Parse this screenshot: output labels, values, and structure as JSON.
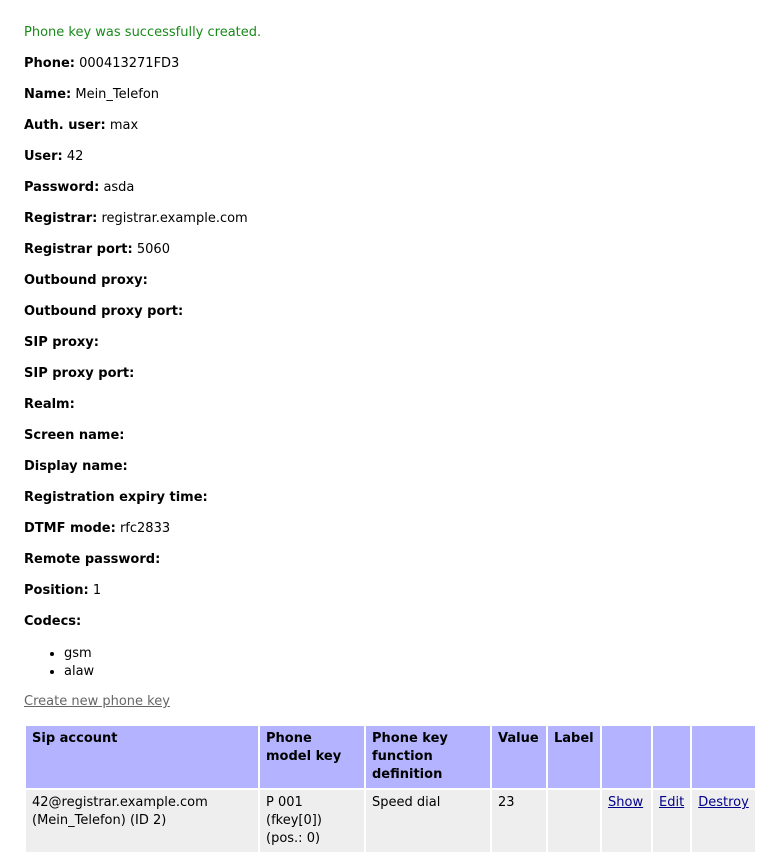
{
  "flash": "Phone key was successfully created.",
  "fields": [
    {
      "label": "Phone:",
      "value": "000413271FD3"
    },
    {
      "label": "Name:",
      "value": "Mein_Telefon"
    },
    {
      "label": "Auth. user:",
      "value": "max"
    },
    {
      "label": "User:",
      "value": "42"
    },
    {
      "label": "Password:",
      "value": "asda"
    },
    {
      "label": "Registrar:",
      "value": "registrar.example.com"
    },
    {
      "label": "Registrar port:",
      "value": "5060"
    },
    {
      "label": "Outbound proxy:",
      "value": ""
    },
    {
      "label": "Outbound proxy port:",
      "value": ""
    },
    {
      "label": "SIP proxy:",
      "value": ""
    },
    {
      "label": "SIP proxy port:",
      "value": ""
    },
    {
      "label": "Realm:",
      "value": ""
    },
    {
      "label": "Screen name:",
      "value": ""
    },
    {
      "label": "Display name:",
      "value": ""
    },
    {
      "label": "Registration expiry time:",
      "value": ""
    },
    {
      "label": "DTMF mode:",
      "value": "rfc2833"
    },
    {
      "label": "Remote password:",
      "value": ""
    },
    {
      "label": "Position:",
      "value": "1"
    },
    {
      "label": "Codecs:",
      "value": ""
    }
  ],
  "codecs": [
    "gsm",
    "alaw"
  ],
  "create_link": "Create new phone key",
  "table": {
    "headers": [
      "Sip account",
      "Phone model key",
      "Phone key function definition",
      "Value",
      "Label",
      "",
      "",
      ""
    ],
    "rows": [
      {
        "sip_account": "42@registrar.example.com (Mein_Telefon) (ID 2)",
        "phone_model_key": "P 001 (fkey[0]) (pos.: 0)",
        "function_definition": "Speed dial",
        "value": "23",
        "label": "",
        "show": "Show",
        "edit": "Edit",
        "destroy": "Destroy"
      }
    ]
  }
}
